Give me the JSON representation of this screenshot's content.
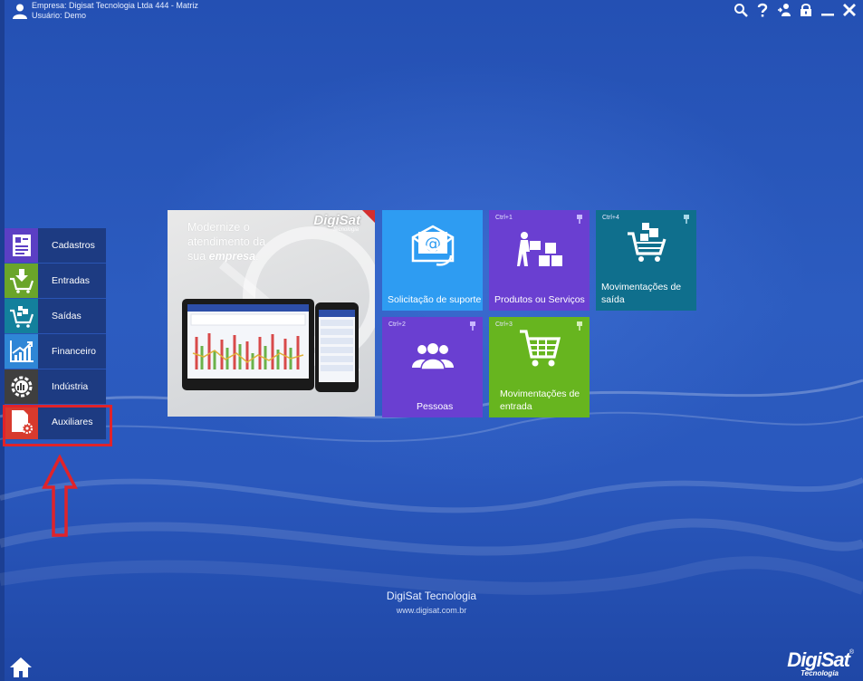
{
  "header": {
    "company": "Empresa:  Digisat Tecnologia Ltda 444 - Matriz",
    "user": "Usuário:  Demo"
  },
  "top_actions": [
    "search-icon",
    "help-icon",
    "switch-user-icon",
    "lock-icon",
    "minimize-icon",
    "close-icon"
  ],
  "side_menu": [
    {
      "label": "Cadastros",
      "color": "#5b3fc4",
      "icon": "document-icon"
    },
    {
      "label": "Entradas",
      "color": "#6aa52a",
      "icon": "cart-in-icon"
    },
    {
      "label": "Saídas",
      "color": "#13809c",
      "icon": "cart-out-icon"
    },
    {
      "label": "Financeiro",
      "color": "#2f86d6",
      "icon": "chart-growth-icon"
    },
    {
      "label": "Indústria",
      "color": "#3f3f3f",
      "icon": "industry-gear-icon"
    },
    {
      "label": "Auxiliares",
      "color": "#d83a2d",
      "icon": "file-gear-icon"
    }
  ],
  "banner": {
    "line1": "Modernize o",
    "line2": "atendimento da",
    "line3_prefix": "sua ",
    "line3_em": "empresa",
    "line3_suffix": ".",
    "brand": "DigiSat",
    "brand_sub": "Tecnologia"
  },
  "tiles": {
    "suporte": {
      "label": "Solicitação de suporte",
      "color": "#2e9cf2"
    },
    "produtos": {
      "shortcut": "Ctrl+1",
      "label": "Produtos ou Serviços",
      "color": "#6a3fd1"
    },
    "mov_saida": {
      "shortcut": "Ctrl+4",
      "label1": "Movimentações de",
      "label2": "saída",
      "color": "#0f6f8d"
    },
    "pessoas": {
      "shortcut": "Ctrl+2",
      "label": "Pessoas",
      "color": "#6a3fd1"
    },
    "mov_entrada": {
      "shortcut": "Ctrl+3",
      "label1": "Movimentações de",
      "label2": "entrada",
      "color": "#67b51f"
    }
  },
  "footer": {
    "title": "DigiSat Tecnologia",
    "url": "www.digisat.com.br",
    "logo": "DigiSat",
    "logo_sub": "Tecnologia",
    "logo_reg": "®"
  }
}
